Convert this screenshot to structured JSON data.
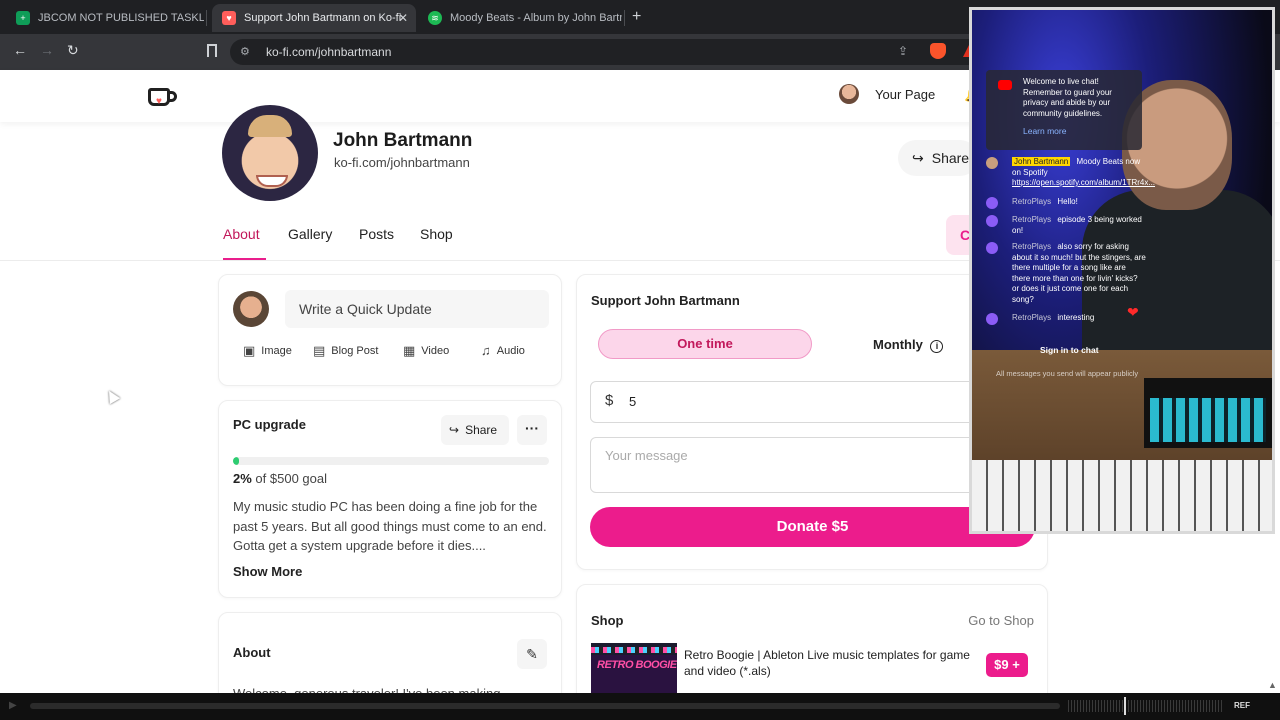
{
  "browser": {
    "tabs": [
      {
        "title": "JBCOM NOT PUBLISHED TASKLIST - ",
        "icon": "sheets-icon",
        "color": "#0f9d58"
      },
      {
        "title": "Support John Bartmann on Ko-fi",
        "icon": "kofi-icon",
        "color": "#ff5e5b"
      },
      {
        "title": "Moody Beats - Album by John Bartn",
        "icon": "spotify-icon",
        "color": "#1db954"
      }
    ],
    "close_glyph": "✕",
    "new_tab_glyph": "+",
    "url": "ko-fi.com/johnbartmann"
  },
  "header": {
    "your_page_label": "Your Page"
  },
  "profile": {
    "name": "John Bartmann",
    "url": "ko-fi.com/johnbartmann",
    "share_label": "Share",
    "create_label": "Cr"
  },
  "nav": {
    "tabs": [
      "About",
      "Gallery",
      "Posts",
      "Shop"
    ],
    "active": "About"
  },
  "quick_update": {
    "placeholder": "Write a Quick Update",
    "actions": [
      "Image",
      "Blog Post",
      "Video",
      "Audio"
    ]
  },
  "goal": {
    "title": "PC upgrade",
    "share_label": "Share",
    "more_glyph": "···",
    "percent": 2,
    "percent_label": "2%",
    "goal_text": "of $500 goal",
    "description": "My music studio PC has been doing a fine job for the past 5 years. But all good things must come to an end. Gotta get a system upgrade before it dies....",
    "show_more": "Show More",
    "accent_color": "#2ecc71"
  },
  "about": {
    "title": "About",
    "text": "Welcome, generous traveler! I've been making"
  },
  "support": {
    "title": "Support John Bartmann",
    "one_time": "One time",
    "monthly": "Monthly",
    "currency": "$",
    "amount": "5",
    "message_placeholder": "Your message",
    "donate_label": "Donate $5",
    "accent_color": "#ec1c8c"
  },
  "shop": {
    "title": "Shop",
    "go_to_shop": "Go to Shop",
    "item_thumb_text": "RETRO BOOGIE",
    "item_title": "Retro Boogie | Ableton Live music templates for game and video (*.als)",
    "item_price": "$9 +"
  },
  "chat": {
    "welcome": "Welcome to live chat! Remember to guard your privacy and abide by our community guidelines.",
    "learn_more": "Learn more",
    "messages": [
      {
        "user": "John Bartmann",
        "text": "Moody Beats now on Spotify ",
        "link": "https://open.spotify.com/album/1TRr4x..."
      },
      {
        "user": "RetroPlays",
        "text": "Hello!"
      },
      {
        "user": "RetroPlays",
        "text": "episode 3 being worked on!"
      },
      {
        "user": "RetroPlays",
        "text": "also sorry for asking about it so much! but the stingers, are there multiple for a song like are there more than one for livin' kicks? or does it just come one for each song?"
      },
      {
        "user": "RetroPlays",
        "text": "interesting"
      }
    ],
    "sign_in": "Sign in to chat",
    "sign_in_sub": "All messages you send will appear publicly"
  },
  "player": {
    "ref_label": "REF"
  }
}
